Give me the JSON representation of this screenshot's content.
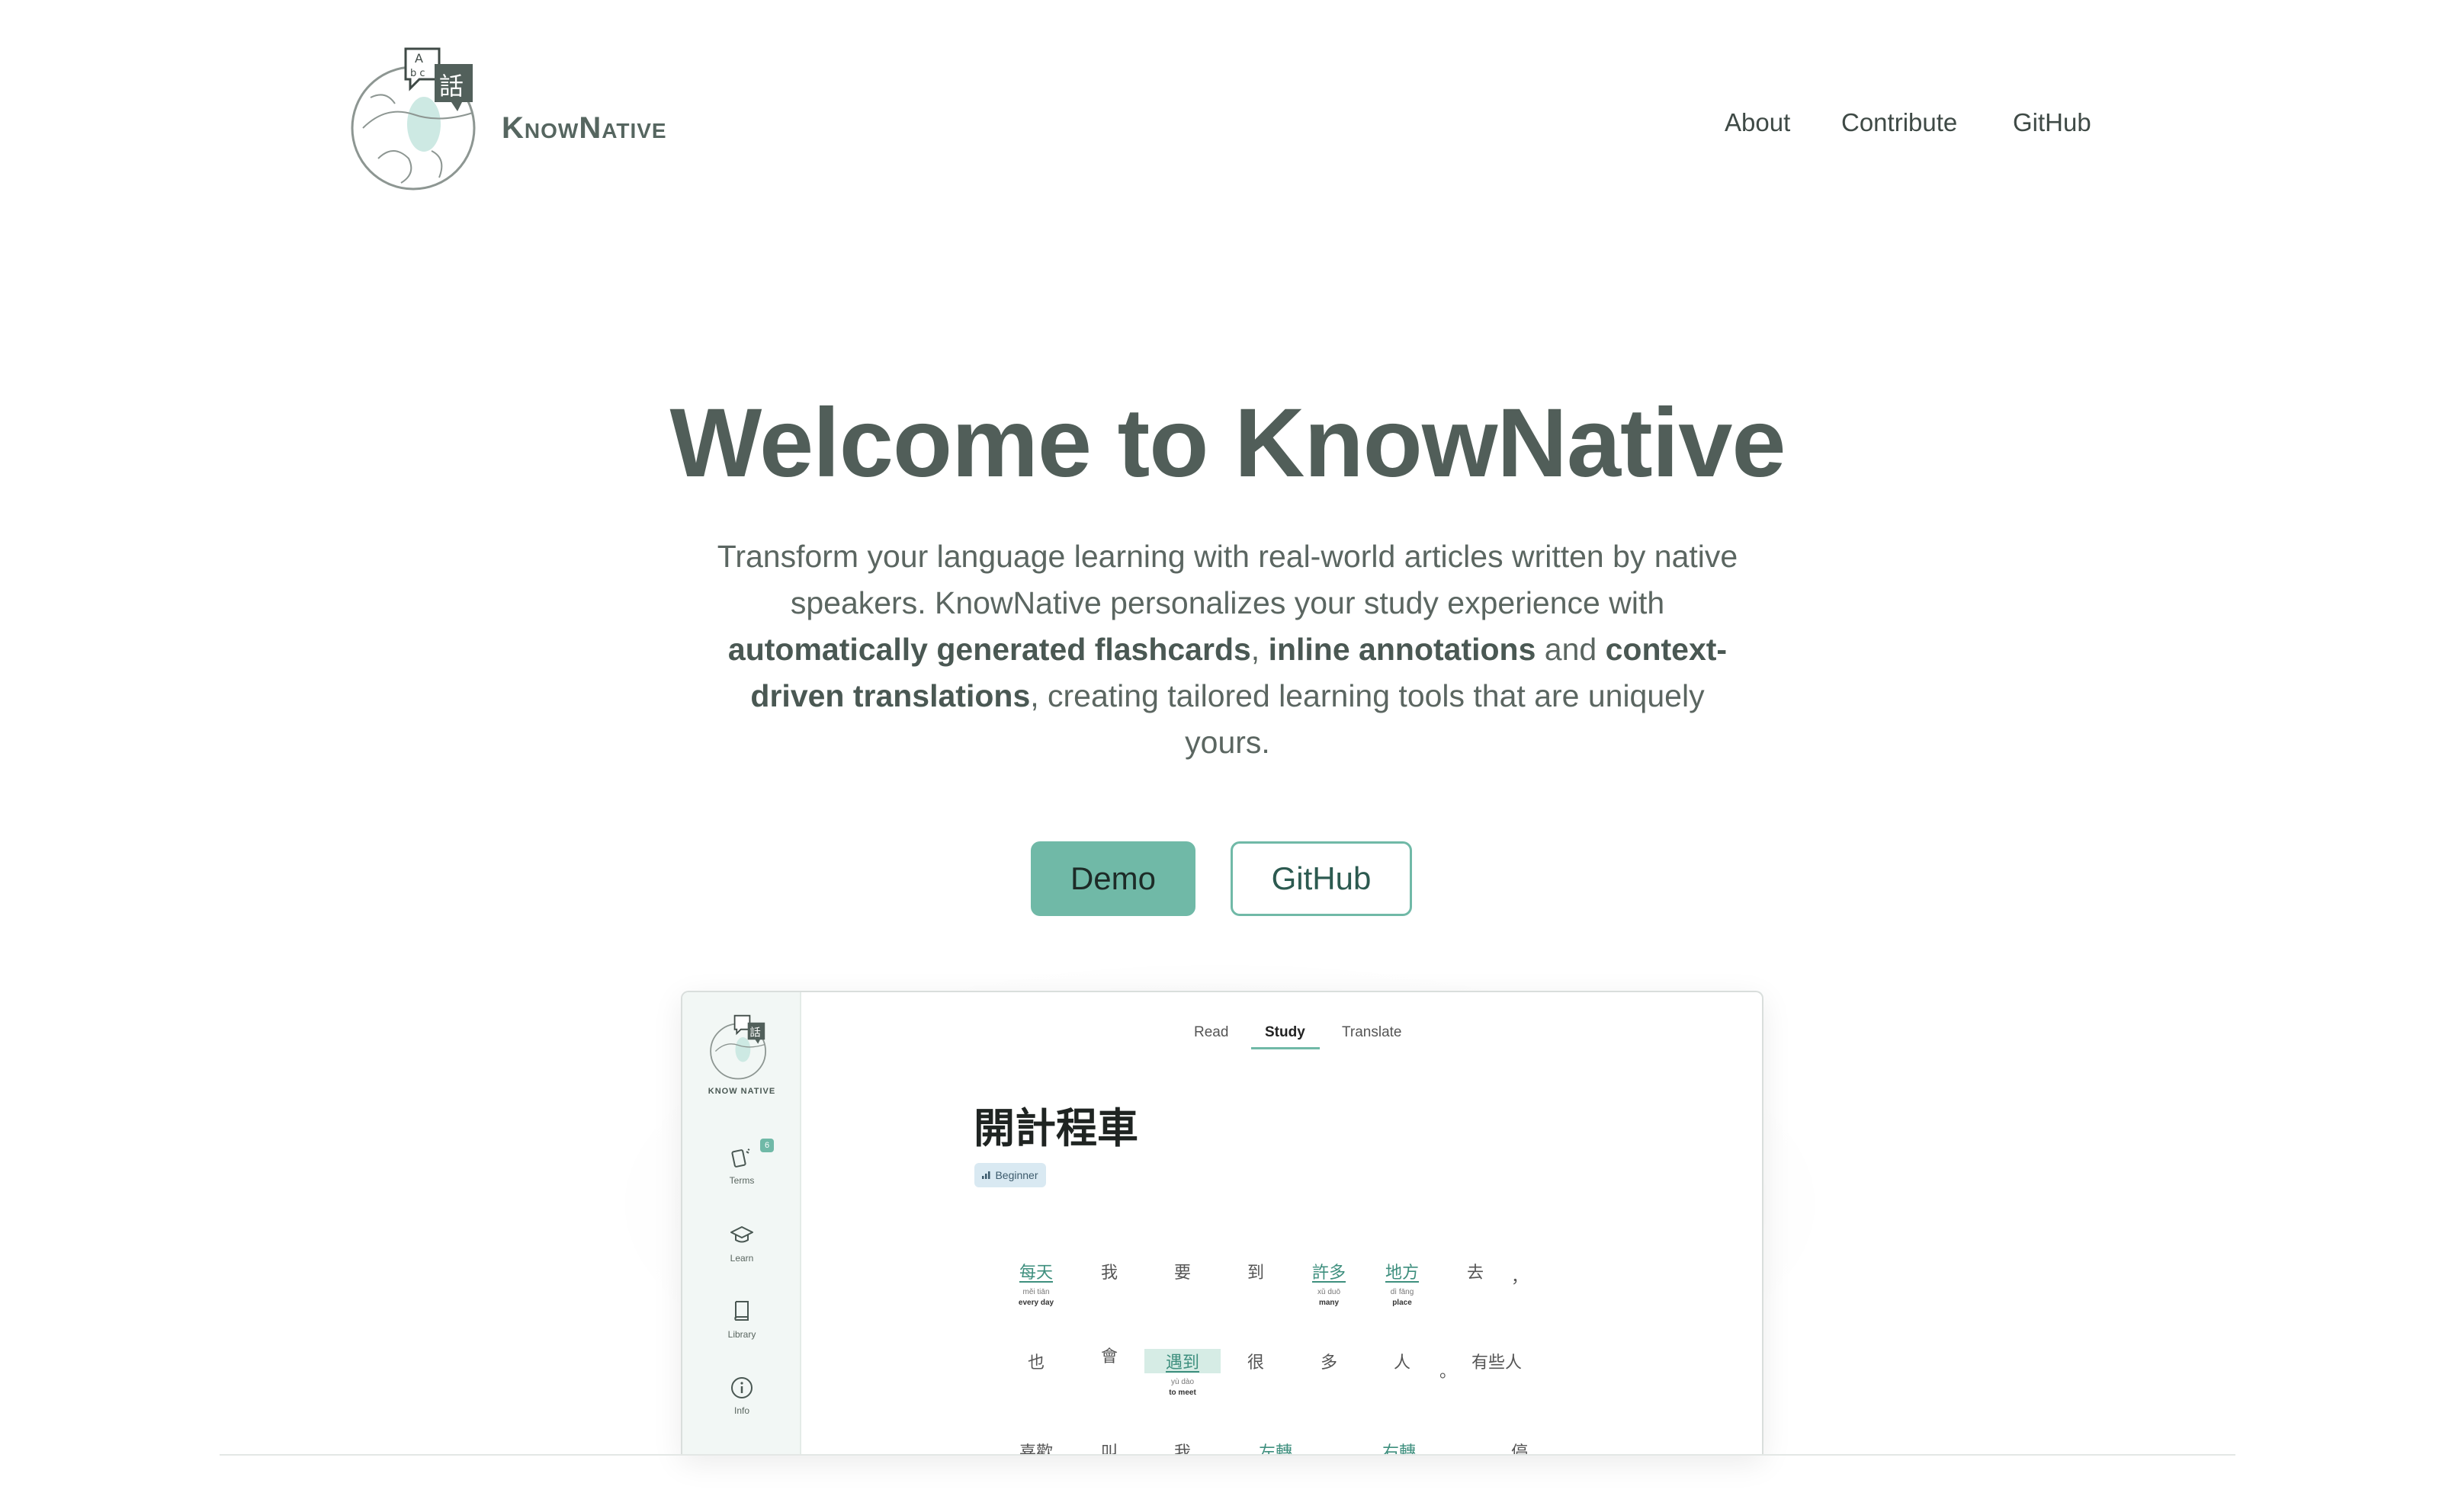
{
  "header": {
    "brand": "KnowNative",
    "nav": [
      {
        "label": "About"
      },
      {
        "label": "Contribute"
      },
      {
        "label": "GitHub"
      }
    ]
  },
  "hero": {
    "title": "Welcome to KnowNative",
    "desc_1": "Transform your language learning with real-world articles written by native speakers. KnowNative personalizes your study experience with ",
    "bold_1": "automatically generated flashcards",
    "sep_1": ", ",
    "bold_2": "inline annotations",
    "sep_2": " and ",
    "bold_3": "context-driven translations",
    "desc_2": ", creating tailored learning tools that are uniquely yours.",
    "demo_button": "Demo",
    "github_button": "GitHub"
  },
  "preview": {
    "sidebar": {
      "brand": "KNOW NATIVE",
      "items": [
        {
          "label": "Terms",
          "badge": "6"
        },
        {
          "label": "Learn"
        },
        {
          "label": "Library"
        },
        {
          "label": "Info"
        }
      ]
    },
    "tabs": [
      "Read",
      "Study",
      "Translate"
    ],
    "active_tab": "Study",
    "article_title": "開計程車",
    "level": "Beginner",
    "words": [
      {
        "zh": "每天",
        "py": "měi tiān",
        "en": "every day"
      },
      {
        "zh": "我"
      },
      {
        "zh": "要"
      },
      {
        "zh": "到"
      },
      {
        "zh": "許多",
        "py": "xǔ duō",
        "en": "many"
      },
      {
        "zh": "地方",
        "py": "dì fāng",
        "en": "place"
      },
      {
        "zh": "去"
      },
      {
        "zh": "，"
      },
      {
        "zh": "也"
      },
      {
        "zh": "會"
      },
      {
        "zh": "遇到",
        "py": "yù dào",
        "en": "to meet"
      },
      {
        "zh": "很"
      },
      {
        "zh": "多"
      },
      {
        "zh": "人"
      },
      {
        "zh": "。"
      },
      {
        "zh": "有些人"
      },
      {
        "zh": "喜歡"
      },
      {
        "zh": "叫"
      },
      {
        "zh": "我"
      },
      {
        "zh": "左轉"
      },
      {
        "zh": "右轉"
      },
      {
        "zh": "停"
      }
    ]
  }
}
